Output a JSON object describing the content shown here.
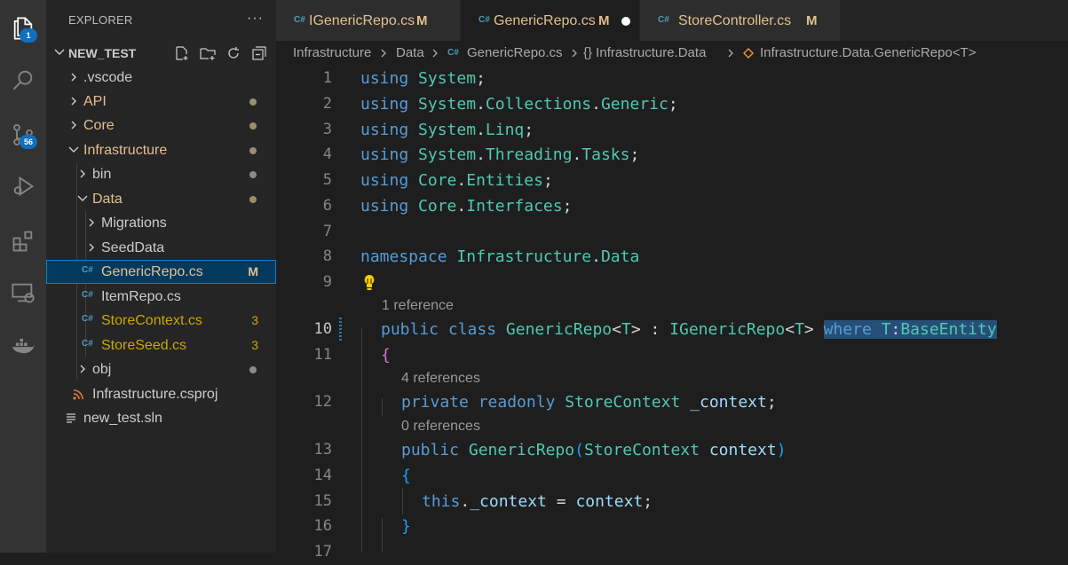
{
  "activity_bar": {
    "items": [
      {
        "icon": "explorer-icon",
        "badge": "1"
      },
      {
        "icon": "search-icon",
        "badge": ""
      },
      {
        "icon": "source-control-icon",
        "badge": "56"
      },
      {
        "icon": "run-debug-icon",
        "badge": ""
      },
      {
        "icon": "extensions-icon",
        "badge": ""
      },
      {
        "icon": "remote-explorer-icon",
        "badge": ""
      },
      {
        "icon": "docker-icon",
        "badge": ""
      }
    ]
  },
  "sidebar": {
    "title": "EXPLORER",
    "more": "···",
    "project": "NEW_TEST",
    "tree": [
      {
        "label": ".vscode",
        "kind": "folder",
        "open": false,
        "color": "#cccccc",
        "status": ""
      },
      {
        "label": "API",
        "kind": "folder",
        "open": false,
        "color": "#e2c08d",
        "status": "dot"
      },
      {
        "label": "Core",
        "kind": "folder",
        "open": false,
        "color": "#e2c08d",
        "status": "dot"
      },
      {
        "label": "Infrastructure",
        "kind": "folder",
        "open": true,
        "color": "#e2c08d",
        "status": "dot"
      },
      {
        "label": "bin",
        "kind": "folder",
        "open": false,
        "color": "#cccccc",
        "status": "dot"
      },
      {
        "label": "Data",
        "kind": "folder",
        "open": true,
        "color": "#e2c08d",
        "status": "dot"
      },
      {
        "label": "Migrations",
        "kind": "folder",
        "open": false,
        "color": "#cccccc",
        "status": ""
      },
      {
        "label": "SeedData",
        "kind": "folder",
        "open": false,
        "color": "#cccccc",
        "status": ""
      },
      {
        "label": "GenericRepo.cs",
        "kind": "cs",
        "color": "#e2c08d",
        "status": "M",
        "selected": true
      },
      {
        "label": "ItemRepo.cs",
        "kind": "cs",
        "color": "#cccccc",
        "status": ""
      },
      {
        "label": "StoreContext.cs",
        "kind": "cs",
        "color": "#cca700",
        "status": "3"
      },
      {
        "label": "StoreSeed.cs",
        "kind": "cs",
        "color": "#cca700",
        "status": "3"
      },
      {
        "label": "obj",
        "kind": "folder",
        "open": false,
        "color": "#cccccc",
        "status": "dot"
      },
      {
        "label": "Infrastructure.csproj",
        "kind": "rss",
        "color": "#cccccc",
        "status": ""
      },
      {
        "label": "new_test.sln",
        "kind": "sln",
        "color": "#cccccc",
        "status": ""
      }
    ]
  },
  "tabs": [
    {
      "label": "IGenericRepo.cs",
      "modified": "M",
      "active": false
    },
    {
      "label": "GenericRepo.cs",
      "modified": "M",
      "active": true,
      "unsaved": true
    },
    {
      "label": "StoreController.cs",
      "modified": "M",
      "active": false
    }
  ],
  "breadcrumb": [
    "Infrastructure",
    "Data",
    "GenericRepo.cs",
    "{} Infrastructure.Data",
    "Infrastructure.Data.GenericRepo<T>"
  ],
  "editor": {
    "current_line": 10,
    "codelens": [
      "1 reference",
      "4 references",
      "0 references"
    ],
    "line_numbers": [
      "1",
      "2",
      "3",
      "4",
      "5",
      "6",
      "7",
      "8",
      "9",
      "10",
      "11",
      "12",
      "13",
      "14",
      "15",
      "16",
      "17"
    ]
  }
}
